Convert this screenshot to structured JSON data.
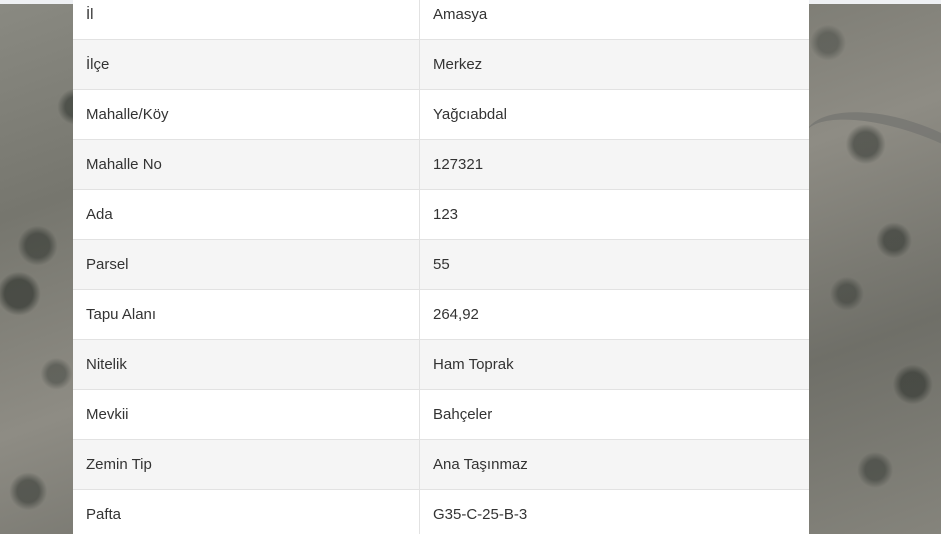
{
  "property_info": {
    "rows": [
      {
        "label": "İl",
        "value": "Amasya"
      },
      {
        "label": "İlçe",
        "value": "Merkez"
      },
      {
        "label": "Mahalle/Köy",
        "value": "Yağcıabdal"
      },
      {
        "label": "Mahalle No",
        "value": "127321"
      },
      {
        "label": "Ada",
        "value": "123"
      },
      {
        "label": "Parsel",
        "value": "55"
      },
      {
        "label": "Tapu Alanı",
        "value": "264,92"
      },
      {
        "label": "Nitelik",
        "value": "Ham Toprak"
      },
      {
        "label": "Mevkii",
        "value": "Bahçeler"
      },
      {
        "label": "Zemin Tip",
        "value": "Ana Taşınmaz"
      },
      {
        "label": "Pafta",
        "value": "G35-C-25-B-3"
      }
    ]
  }
}
